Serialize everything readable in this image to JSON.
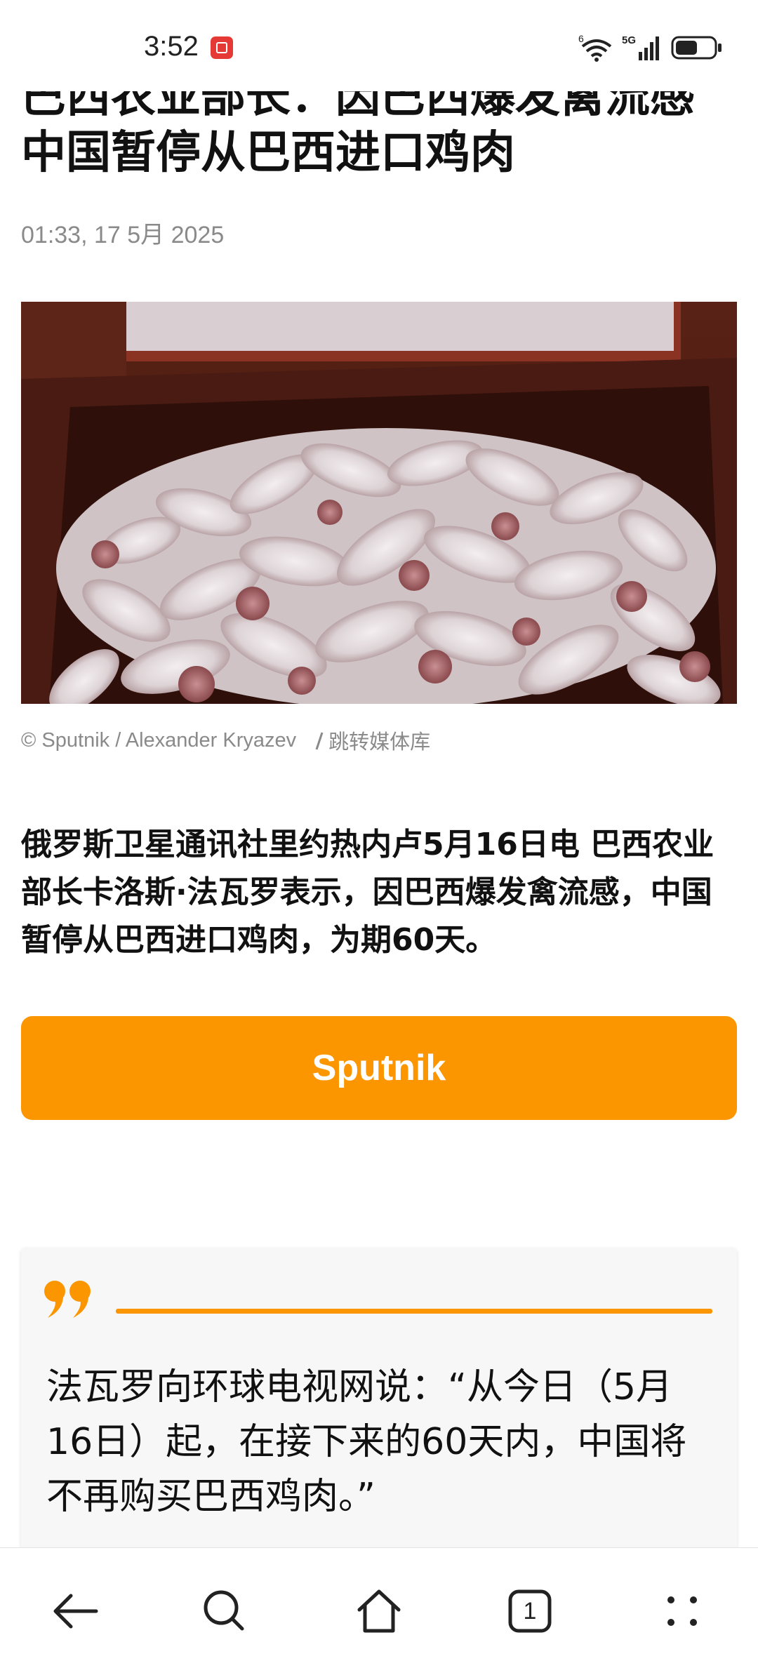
{
  "status_bar": {
    "time": "3:52",
    "wifi_badge": "6",
    "network": "5G",
    "icons": [
      "notification-icon",
      "wifi-icon",
      "signal-icon",
      "battery-icon"
    ]
  },
  "article": {
    "headline": "巴西农业部长：因巴西爆发禽流感中国暂停从巴西进口鸡肉",
    "date": "01:33, 17 5月 2025",
    "image_alt": "chicken drumsticks in crates",
    "photo_credit": "© Sputnik / Alexander Kryazev",
    "media_link": "跳转媒体库",
    "lead": "俄罗斯卫星通讯社里约热内卢5月16日电 巴西农业部长卡洛斯·法瓦罗表示，因巴西爆发禽流感，中国暂停从巴西进口鸡肉，为期60天。",
    "source_button": "Sputnik",
    "quote": "法瓦罗向环球电视网说：“从今日（5月16日）起，在接下来的60天内，中国将不再购买巴西鸡肉。”"
  },
  "bottom_nav": {
    "items": [
      "back-icon",
      "search-icon",
      "home-icon",
      "tabs-icon",
      "menu-icon"
    ],
    "tab_count": "1"
  },
  "colors": {
    "accent": "#fb9600",
    "muted_text": "#8a8a8a",
    "text": "#111111"
  }
}
